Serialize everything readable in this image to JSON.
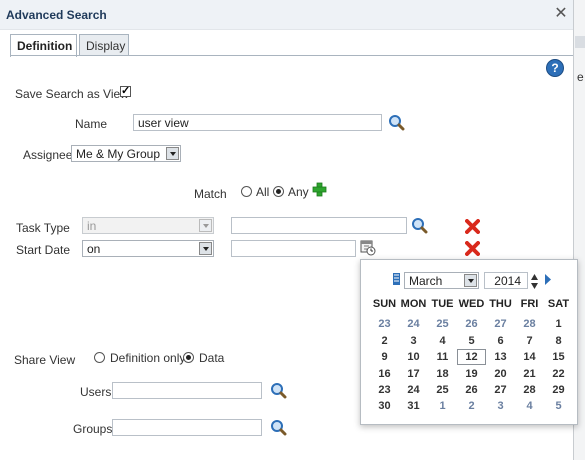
{
  "dialog": {
    "title": "Advanced Search",
    "close_glyph": "✕"
  },
  "edge_text": "e",
  "tabs": [
    {
      "label": "Definition",
      "active": true
    },
    {
      "label": "Display",
      "active": false
    }
  ],
  "form": {
    "save_label": "Save Search as View",
    "save_checked": "✓",
    "name_label": "Name",
    "name_value": "user view",
    "assignee_label": "Assignee",
    "assignee_value": "Me & My Group",
    "match_label": "Match",
    "match_all": "All",
    "match_any": "Any",
    "task_type_label": "Task Type",
    "task_type_op": "in",
    "task_type_value": "",
    "start_date_label": "Start Date",
    "start_date_op": "on",
    "start_date_value": "",
    "share_label": "Share View",
    "share_def": "Definition only",
    "share_data": "Data",
    "users_label": "Users",
    "users_value": "",
    "groups_label": "Groups",
    "groups_value": ""
  },
  "calendar": {
    "month": "March",
    "year": "2014",
    "days": [
      "SUN",
      "MON",
      "TUE",
      "WED",
      "THU",
      "FRI",
      "SAT"
    ],
    "weeks": [
      [
        "23",
        "24",
        "25",
        "26",
        "27",
        "28",
        "1"
      ],
      [
        "2",
        "3",
        "4",
        "5",
        "6",
        "7",
        "8"
      ],
      [
        "9",
        "10",
        "11",
        "12",
        "13",
        "14",
        "15"
      ],
      [
        "16",
        "17",
        "18",
        "19",
        "20",
        "21",
        "22"
      ],
      [
        "23",
        "24",
        "25",
        "26",
        "27",
        "28",
        "29"
      ],
      [
        "30",
        "31",
        "1",
        "2",
        "3",
        "4",
        "5"
      ]
    ],
    "today": "12"
  },
  "colors": {
    "accent": "#2d6fb8",
    "delete": "#d9291c",
    "add": "#2ea52e",
    "title": "#1f3a5a"
  },
  "icons": [
    "close-icon",
    "help-icon",
    "search-icon",
    "add-icon",
    "delete-icon",
    "calendar-icon",
    "next-month-icon",
    "spin-up-icon",
    "spin-down-icon"
  ]
}
